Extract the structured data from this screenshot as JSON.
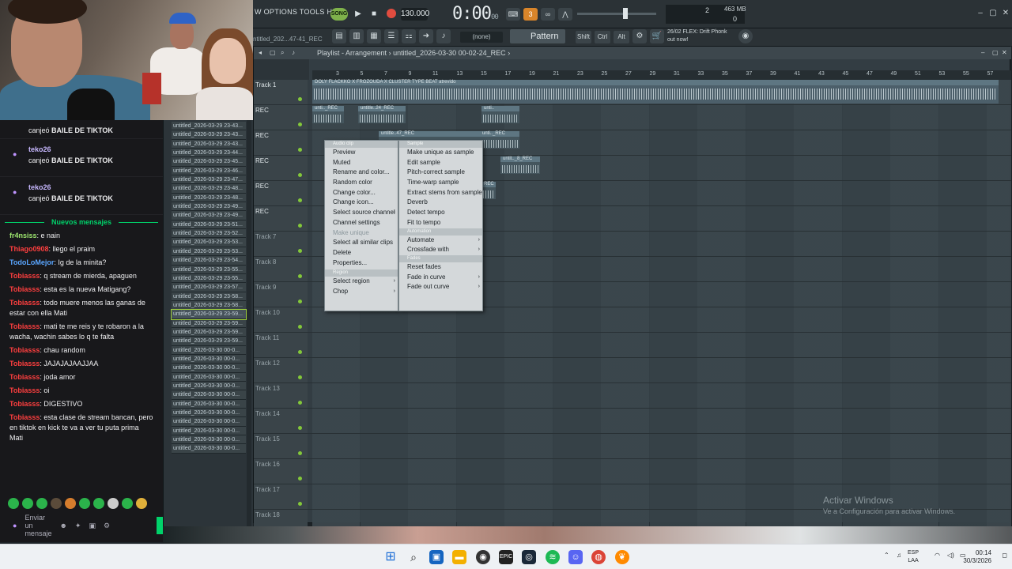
{
  "fl_menu": [
    "W",
    "OPTIONS",
    "TOOLS",
    "HELP"
  ],
  "fl_menu_text": "W  OPTIONS  TOOLS  HELP",
  "song_label": "SONG",
  "tempo": "130.000",
  "time_display": "0:00",
  "time_sub": "00",
  "time_units": "M:S:CS",
  "cpu_value": "2",
  "cpu_value2": "0",
  "memory": "463 MB",
  "project_short": "ntitled_202...47-41_REC",
  "snap_value": "(none)",
  "pattern_label": "Pattern 1",
  "mod_keys": [
    "Shift",
    "Ctrl",
    "Alt"
  ],
  "hint": {
    "date": "26/02",
    "line1": "FLEX: Drift Phonk",
    "line2": "out now!"
  },
  "playlist_title": "Playlist - Arrangement",
  "playlist_path": "untitled_2026-03-30 00-02-24_REC",
  "ruler_ticks": [
    "3",
    "5",
    "7",
    "9",
    "11",
    "13",
    "15",
    "17",
    "19",
    "21",
    "23",
    "25",
    "27",
    "29",
    "31",
    "33",
    "35",
    "37",
    "39",
    "41",
    "43",
    "45",
    "47",
    "49",
    "51",
    "53",
    "55",
    "57"
  ],
  "tracks": [
    {
      "name": "Track 1"
    },
    {
      "name": "REC"
    },
    {
      "name": "REC"
    },
    {
      "name": "REC"
    },
    {
      "name": "REC"
    },
    {
      "name": "REC"
    },
    {
      "name": "Track 7"
    },
    {
      "name": "Track 8"
    },
    {
      "name": "Track 9"
    },
    {
      "name": "Track 10"
    },
    {
      "name": "Track 11"
    },
    {
      "name": "Track 12"
    },
    {
      "name": "Track 13"
    },
    {
      "name": "Track 14"
    },
    {
      "name": "Track 15"
    },
    {
      "name": "Track 16"
    },
    {
      "name": "Track 17"
    },
    {
      "name": "Track 18"
    }
  ],
  "clips": {
    "main": "DOLY FLACKKO X FROZOUDA X CLUSTER TYPE BEAT atrevido",
    "c1": "unti.._REC",
    "c2": "untitle..24_REC",
    "c3": "unti..",
    "c4": "untitle..47_REC",
    "c5": "unti.._REC",
    "c6": "untit.._8_REC",
    "c7": "REC"
  },
  "menu_left": {
    "header": "Audio clip",
    "items": [
      {
        "label": "Preview"
      },
      {
        "label": "Muted"
      },
      {
        "label": "Rename and color..."
      },
      {
        "label": "Random color"
      },
      {
        "label": "Change color..."
      },
      {
        "label": "Change icon..."
      },
      {
        "label": "Select source channel",
        "arrow": true
      },
      {
        "label": "Channel settings"
      },
      {
        "label": "Make unique",
        "dim": true
      },
      {
        "label": "Select all similar clips"
      },
      {
        "label": "Delete"
      },
      {
        "label": "Properties..."
      }
    ],
    "region_header": "Region",
    "region_items": [
      {
        "label": "Select region",
        "arrow": true
      },
      {
        "label": "Chop",
        "arrow": true
      }
    ]
  },
  "menu_right": {
    "header": "Sample",
    "items": [
      {
        "label": "Make unique as sample"
      },
      {
        "label": "Edit sample"
      },
      {
        "label": "Pitch-correct sample"
      },
      {
        "label": "Time-warp sample"
      },
      {
        "label": "Extract stems from sample"
      },
      {
        "label": "Deverb"
      },
      {
        "label": "Detect tempo"
      },
      {
        "label": "Fit to tempo"
      }
    ],
    "automation_header": "Automation",
    "automation_items": [
      {
        "label": "Automate",
        "arrow": true
      },
      {
        "label": "Crossfade with",
        "arrow": true
      }
    ],
    "fades_header": "Fades",
    "fades_items": [
      {
        "label": "Reset fades"
      },
      {
        "label": "Fade in curve",
        "arrow": true
      },
      {
        "label": "Fade out curve",
        "arrow": true
      }
    ]
  },
  "files": [
    "untitled_2026-03-29 23-43...",
    "untitled_2026-03-29 23-43...",
    "untitled_2026-03-29 23-43...",
    "untitled_2026-03-29 23-44...",
    "untitled_2026-03-29 23-45...",
    "untitled_2026-03-29 23-46...",
    "untitled_2026-03-29 23-47...",
    "untitled_2026-03-29 23-48...",
    "untitled_2026-03-29 23-48...",
    "untitled_2026-03-29 23-49...",
    "untitled_2026-03-29 23-49...",
    "untitled_2026-03-29 23-51...",
    "untitled_2026-03-29 23-52...",
    "untitled_2026-03-29 23-53...",
    "untitled_2026-03-29 23-53...",
    "untitled_2026-03-29 23-54...",
    "untitled_2026-03-29 23-55...",
    "untitled_2026-03-29 23-55...",
    "untitled_2026-03-29 23-57...",
    "untitled_2026-03-29 23-58...",
    "untitled_2026-03-29 23-58...",
    "untitled_2026-03-29 23-59...",
    "untitled_2026-03-29 23-59...",
    "untitled_2026-03-29 23-59...",
    "untitled_2026-03-29 23-59...",
    "untitled_2026-03-30 00-0...",
    "untitled_2026-03-30 00-0...",
    "untitled_2026-03-30 00-0...",
    "untitled_2026-03-30 00-0...",
    "untitled_2026-03-30 00-0...",
    "untitled_2026-03-30 00-0...",
    "untitled_2026-03-30 00-0...",
    "untitled_2026-03-30 00-0...",
    "untitled_2026-03-30 00-0...",
    "untitled_2026-03-30 00-0...",
    "untitled_2026-03-30 00-0...",
    "untitled_2026-03-30 00-0..."
  ],
  "selected_file_index": 21,
  "chat": {
    "redeems": [
      {
        "user": "",
        "action": "canjeó",
        "reward": "BAILE DE TIKTOK"
      },
      {
        "user": "teko26",
        "action": "canjeó",
        "reward": "BAILE DE TIKTOK"
      },
      {
        "user": "teko26",
        "action": "canjeó",
        "reward": "BAILE DE TIKTOK"
      }
    ],
    "new_messages_label": "Nuevos mensajes",
    "messages": [
      {
        "user": "fr4nsiss",
        "color": "#9fe870",
        "text": ": e nain"
      },
      {
        "user": "Thiago0908",
        "color": "#ff3f3f",
        "text": ": llego el praim"
      },
      {
        "user": "TodoLoMejor",
        "color": "#5aa6ff",
        "text": ": Ig de la minita?"
      },
      {
        "user": "Tobiasss",
        "color": "#ff3f3f",
        "text": ": q stream de mierda, apaguen"
      },
      {
        "user": "Tobiasss",
        "color": "#ff3f3f",
        "text": ": esta es la nueva Matigang?"
      },
      {
        "user": "Tobiasss",
        "color": "#ff3f3f",
        "text": ": todo muere menos las ganas de estar con ella Mati"
      },
      {
        "user": "Tobiasss",
        "color": "#ff3f3f",
        "text": ": mati te me reis y te robaron a la wacha, wachin sabes lo q te falta"
      },
      {
        "user": "Tobiasss",
        "color": "#ff3f3f",
        "text": ": chau random"
      },
      {
        "user": "Tobiasss",
        "color": "#ff3f3f",
        "text": ": JAJAJAJAAJJAA"
      },
      {
        "user": "Tobiasss",
        "color": "#ff3f3f",
        "text": ": joda amor"
      },
      {
        "user": "Tobiasss",
        "color": "#ff3f3f",
        "text": ": oi"
      },
      {
        "user": "Tobiasss",
        "color": "#ff3f3f",
        "text": ": DIGESTIVO"
      },
      {
        "user": "Tobiasss",
        "color": "#ff3f3f",
        "text": ": esta clase de stream bancan, pero en tiktok en kick te va a ver tu puta prima Mati"
      }
    ],
    "input_placeholder": "Enviar un mensaje"
  },
  "watermark": {
    "title": "Activar Windows",
    "subtitle": "Ve a Configuración para activar Windows."
  },
  "tray": {
    "lang1": "ESP",
    "lang2": "LAA",
    "time": "00:14",
    "date": "30/3/2026"
  }
}
